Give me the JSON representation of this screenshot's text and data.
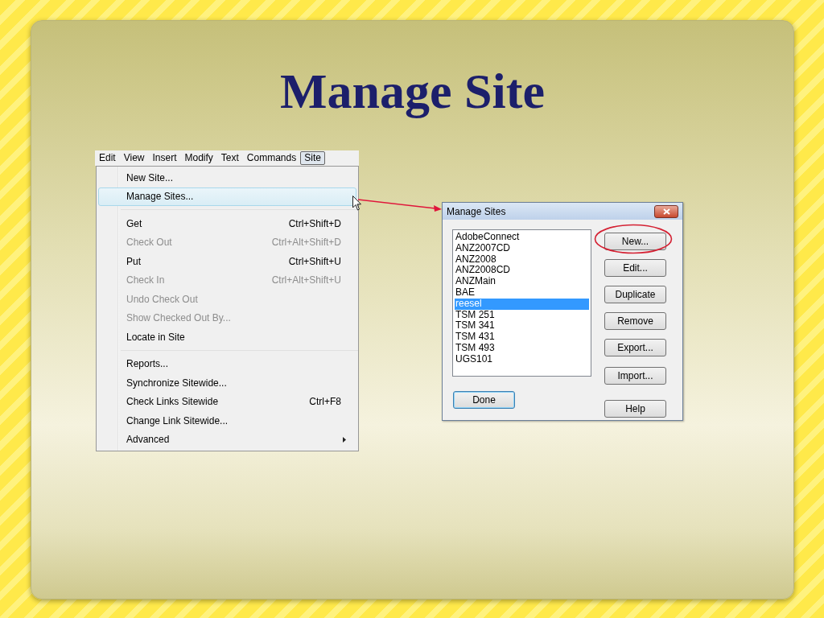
{
  "slide": {
    "title": "Manage Site"
  },
  "menubar": [
    {
      "label": "Edit",
      "selected": false
    },
    {
      "label": "View",
      "selected": false
    },
    {
      "label": "Insert",
      "selected": false
    },
    {
      "label": "Modify",
      "selected": false
    },
    {
      "label": "Text",
      "selected": false
    },
    {
      "label": "Commands",
      "selected": false
    },
    {
      "label": "Site",
      "selected": true
    }
  ],
  "menu": [
    {
      "kind": "item",
      "label": "New Site...",
      "disabled": false,
      "selected": false
    },
    {
      "kind": "item",
      "label": "Manage Sites...",
      "disabled": false,
      "selected": true
    },
    {
      "kind": "separator"
    },
    {
      "kind": "item",
      "label": "Get",
      "shortcut": "Ctrl+Shift+D",
      "disabled": false,
      "selected": false
    },
    {
      "kind": "item",
      "label": "Check Out",
      "shortcut": "Ctrl+Alt+Shift+D",
      "disabled": true,
      "selected": false
    },
    {
      "kind": "item",
      "label": "Put",
      "shortcut": "Ctrl+Shift+U",
      "disabled": false,
      "selected": false
    },
    {
      "kind": "item",
      "label": "Check In",
      "shortcut": "Ctrl+Alt+Shift+U",
      "disabled": true,
      "selected": false
    },
    {
      "kind": "item",
      "label": "Undo Check Out",
      "disabled": true,
      "selected": false
    },
    {
      "kind": "item",
      "label": "Show Checked Out By...",
      "disabled": true,
      "selected": false
    },
    {
      "kind": "item",
      "label": "Locate in Site",
      "disabled": false,
      "selected": false
    },
    {
      "kind": "separator"
    },
    {
      "kind": "item",
      "label": "Reports...",
      "disabled": false,
      "selected": false
    },
    {
      "kind": "item",
      "label": "Synchronize Sitewide...",
      "disabled": false,
      "selected": false
    },
    {
      "kind": "item",
      "label": "Check Links Sitewide",
      "shortcut": "Ctrl+F8",
      "disabled": false,
      "selected": false
    },
    {
      "kind": "item",
      "label": "Change Link Sitewide...",
      "disabled": false,
      "selected": false
    },
    {
      "kind": "item",
      "label": "Advanced",
      "submenu": true,
      "disabled": false,
      "selected": false
    }
  ],
  "dialog": {
    "title": "Manage Sites",
    "sites": [
      {
        "label": "AdobeConnect",
        "selected": false
      },
      {
        "label": "ANZ2007CD",
        "selected": false
      },
      {
        "label": "ANZ2008",
        "selected": false
      },
      {
        "label": "ANZ2008CD",
        "selected": false
      },
      {
        "label": "ANZMain",
        "selected": false
      },
      {
        "label": "BAE",
        "selected": false
      },
      {
        "label": "reesel",
        "selected": true
      },
      {
        "label": "TSM 251",
        "selected": false
      },
      {
        "label": "TSM 341",
        "selected": false
      },
      {
        "label": "TSM 431",
        "selected": false
      },
      {
        "label": "TSM 493",
        "selected": false
      },
      {
        "label": "UGS101",
        "selected": false
      }
    ],
    "buttons": [
      {
        "label": "New...",
        "circled": true
      },
      {
        "label": "Edit...",
        "circled": false
      },
      {
        "label": "Duplicate",
        "circled": false
      },
      {
        "label": "Remove",
        "circled": false
      },
      {
        "label": "Export...",
        "circled": false
      },
      {
        "label": "Import...",
        "circled": false
      }
    ],
    "done_button": {
      "label": "Done",
      "default": true
    },
    "help_button": {
      "label": "Help"
    }
  }
}
